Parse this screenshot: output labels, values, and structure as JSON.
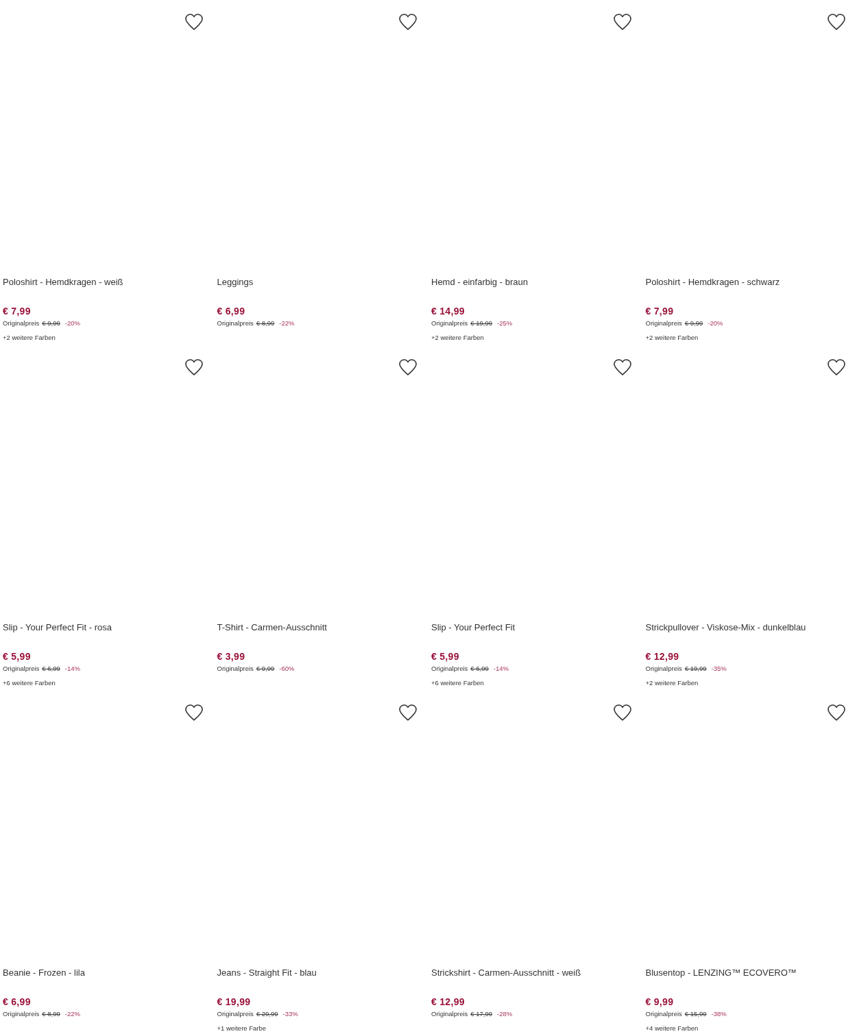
{
  "products": [
    {
      "name": "Poloshirt - Hemdkragen - weiß",
      "price": "€ 7,99",
      "original_label": "Originalpreis",
      "original_price": "€ 9,99",
      "discount": "-20%",
      "more_colors": "+2 weitere Farben"
    },
    {
      "name": "Leggings",
      "price": "€ 6,99",
      "original_label": "Originalpreis",
      "original_price": "€ 8,99",
      "discount": "-22%"
    },
    {
      "name": "Hemd - einfarbig - braun",
      "price": "€ 14,99",
      "original_label": "Originalpreis",
      "original_price": "€ 19,99",
      "discount": "-25%",
      "more_colors": "+2 weitere Farben"
    },
    {
      "name": "Poloshirt - Hemdkragen - schwarz",
      "price": "€ 7,99",
      "original_label": "Originalpreis",
      "original_price": "€ 9,99",
      "discount": "-20%",
      "more_colors": "+2 weitere Farben"
    },
    {
      "name": "Slip - Your Perfect Fit - rosa",
      "price": "€ 5,99",
      "original_label": "Originalpreis",
      "original_price": "€ 6,99",
      "discount": "-14%",
      "more_colors": "+6 weitere Farben"
    },
    {
      "name": "T-Shirt - Carmen-Ausschnitt",
      "price": "€ 3,99",
      "original_label": "Originalpreis",
      "original_price": "€ 9,99",
      "discount": "-60%"
    },
    {
      "name": "Slip - Your Perfect Fit",
      "price": "€ 5,99",
      "original_label": "Originalpreis",
      "original_price": "€ 6,99",
      "discount": "-14%",
      "more_colors": "+6 weitere Farben"
    },
    {
      "name": "Strickpullover - Viskose-Mix - dunkelblau",
      "price": "€ 12,99",
      "original_label": "Originalpreis",
      "original_price": "€ 19,99",
      "discount": "-35%",
      "more_colors": "+2 weitere Farben"
    },
    {
      "name": "Beanie - Frozen - lila",
      "price": "€ 6,99",
      "original_label": "Originalpreis",
      "original_price": "€ 8,99",
      "discount": "-22%"
    },
    {
      "name": "Jeans - Straight Fit - blau",
      "price": "€ 19,99",
      "original_label": "Originalpreis",
      "original_price": "€ 29,99",
      "discount": "-33%",
      "more_colors": "+1 weitere Farbe"
    },
    {
      "name": "Strickshirt - Carmen-Ausschnitt - weiß",
      "price": "€ 12,99",
      "original_label": "Originalpreis",
      "original_price": "€ 17,99",
      "discount": "-28%"
    },
    {
      "name": "Blusentop - LENZING™ ECOVERO™",
      "price": "€ 9,99",
      "original_label": "Originalpreis",
      "original_price": "€ 15,99",
      "discount": "-38%",
      "more_colors": "+4 weitere Farben"
    }
  ]
}
